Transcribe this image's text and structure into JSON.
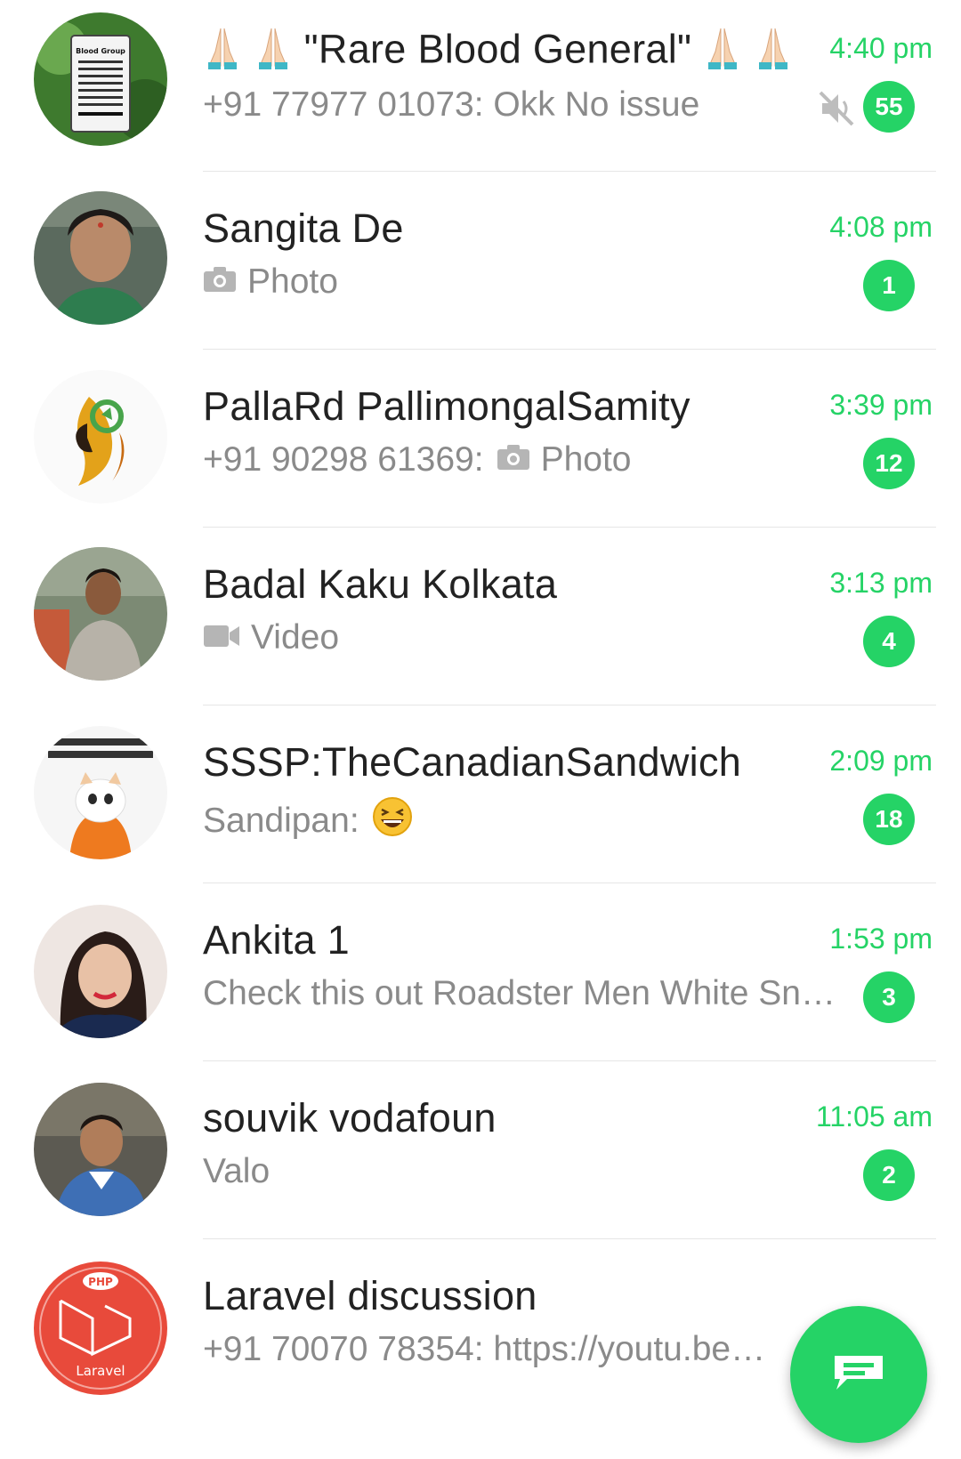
{
  "colors": {
    "accent": "#25d366",
    "name_text": "#222222",
    "preview_text": "#8a8a8a"
  },
  "chats": [
    {
      "name_prefix_icons": [
        "folded-hands-emoji",
        "folded-hands-emoji"
      ],
      "name": "\"Rare Blood General\"",
      "name_suffix_icons": [
        "folded-hands-emoji",
        "folded-hands-emoji"
      ],
      "time": "4:40 pm",
      "preview": "+91 77977 01073: Okk No issue",
      "muted": true,
      "unread": "55"
    },
    {
      "name": "Sangita De",
      "time": "4:08 pm",
      "preview_icon": "camera-icon",
      "preview": "Photo",
      "unread": "1"
    },
    {
      "name": "PallaRd PallimongalSamity",
      "time": "3:39 pm",
      "preview_sender": "+91 90298 61369:",
      "preview_icon": "camera-icon",
      "preview": "Photo",
      "unread": "12"
    },
    {
      "name": "Badal Kaku Kolkata",
      "time": "3:13 pm",
      "preview_icon": "video-camera-icon",
      "preview": "Video",
      "unread": "4"
    },
    {
      "name": "SSSP:TheCanadianSandwich",
      "time": "2:09 pm",
      "preview": "Sandipan:",
      "preview_emoji": "grinning-squinting-face-emoji",
      "unread": "18"
    },
    {
      "name": "Ankita 1",
      "time": "1:53 pm",
      "preview": "Check this out Roadster Men White Sn…",
      "unread": "3"
    },
    {
      "name": "souvik vodafoun",
      "time": "11:05 am",
      "preview": "Valo",
      "unread": "2"
    },
    {
      "name": "Laravel discussion",
      "time": "",
      "preview": "+91 70070 78354: https://youtu.be…",
      "unread": ""
    }
  ],
  "avatars": {
    "blood_group_label": "Blood Group",
    "php_label": "PHP",
    "laravel_label": "Laravel"
  },
  "fab": {
    "icon": "new-chat-icon"
  }
}
